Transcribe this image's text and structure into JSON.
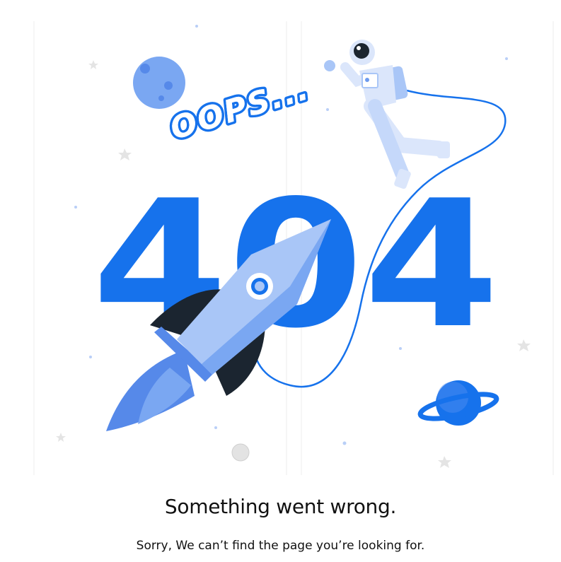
{
  "illustration": {
    "code": "404",
    "exclamation": "OOPS...",
    "colors": {
      "primary": "#1672ec",
      "light": "#a9c6f7",
      "mid": "#6d9bef",
      "dark": "#1b2530",
      "pale": "#dbe6fb"
    }
  },
  "message": {
    "title": "Something went wrong.",
    "subtitle": "Sorry, We can’t find the page you’re looking for."
  }
}
